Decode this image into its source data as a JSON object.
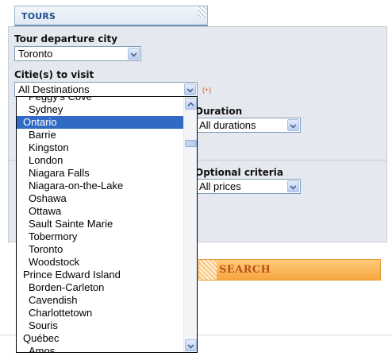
{
  "tab": {
    "title": "TOURS"
  },
  "departure": {
    "label": "Tour departure city",
    "value": "Toronto"
  },
  "cities": {
    "label": "Citie(s) to visit",
    "value": "All Destinations",
    "hint": "(+)"
  },
  "duration": {
    "label": "Duration",
    "value": "All durations"
  },
  "optional": {
    "label": "Optional criteria",
    "value": "All prices"
  },
  "search": {
    "label": "SEARCH"
  },
  "dropdown": {
    "items": [
      {
        "label": "Peggy's Cove",
        "group": false,
        "selected": false
      },
      {
        "label": "Sydney",
        "group": false,
        "selected": false
      },
      {
        "label": "Ontario",
        "group": true,
        "selected": true
      },
      {
        "label": "Barrie",
        "group": false,
        "selected": false
      },
      {
        "label": "Kingston",
        "group": false,
        "selected": false
      },
      {
        "label": "London",
        "group": false,
        "selected": false
      },
      {
        "label": "Niagara Falls",
        "group": false,
        "selected": false
      },
      {
        "label": "Niagara-on-the-Lake",
        "group": false,
        "selected": false
      },
      {
        "label": "Oshawa",
        "group": false,
        "selected": false
      },
      {
        "label": "Ottawa",
        "group": false,
        "selected": false
      },
      {
        "label": "Sault Sainte Marie",
        "group": false,
        "selected": false
      },
      {
        "label": "Tobermory",
        "group": false,
        "selected": false
      },
      {
        "label": "Toronto",
        "group": false,
        "selected": false
      },
      {
        "label": "Woodstock",
        "group": false,
        "selected": false
      },
      {
        "label": "Prince Edward Island",
        "group": true,
        "selected": false
      },
      {
        "label": "Borden-Carleton",
        "group": false,
        "selected": false
      },
      {
        "label": "Cavendish",
        "group": false,
        "selected": false
      },
      {
        "label": "Charlottetown",
        "group": false,
        "selected": false
      },
      {
        "label": "Souris",
        "group": false,
        "selected": false
      },
      {
        "label": "Québec",
        "group": true,
        "selected": false
      },
      {
        "label": "Amos",
        "group": false,
        "selected": false
      }
    ]
  }
}
